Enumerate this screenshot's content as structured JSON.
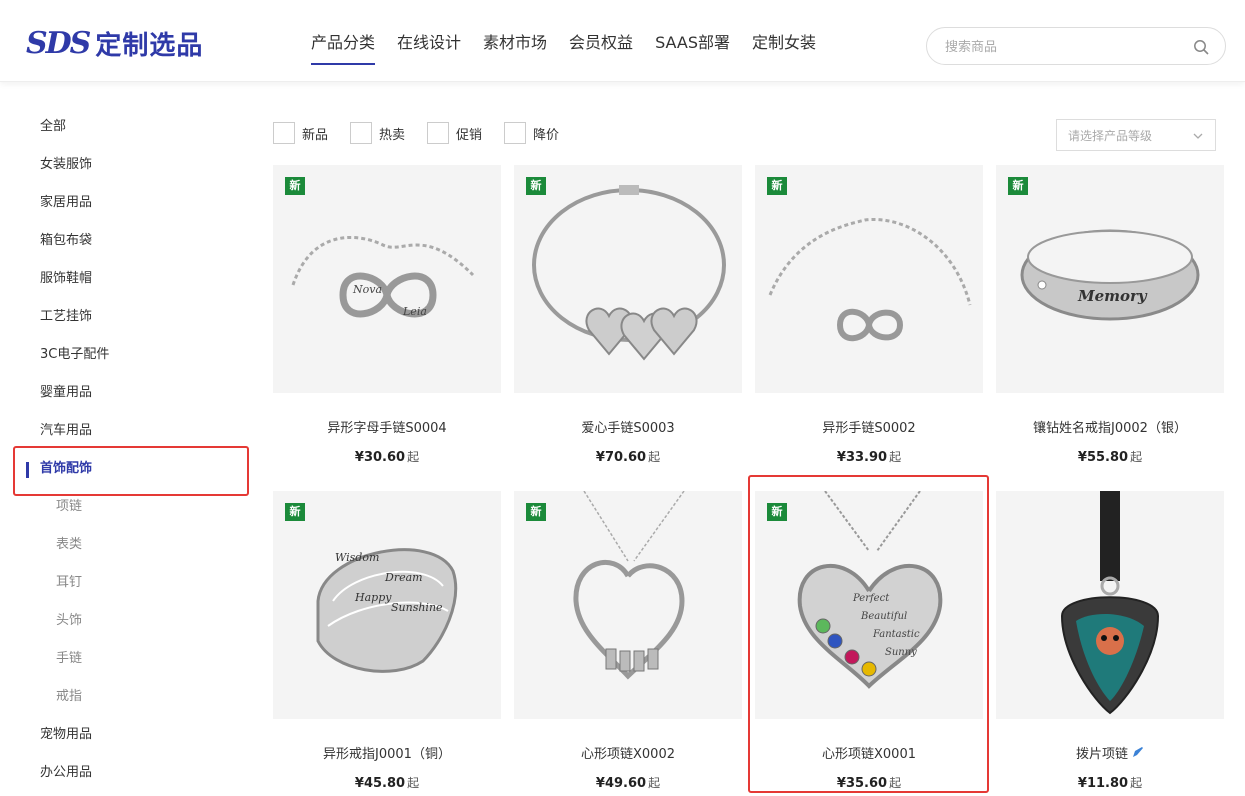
{
  "header": {
    "logo_mark": "SDS",
    "logo_text": "定制选品",
    "nav": [
      "产品分类",
      "在线设计",
      "素材市场",
      "会员权益",
      "SAAS部署",
      "定制女装"
    ],
    "search_placeholder": "搜索商品"
  },
  "sidebar": {
    "categories": [
      "全部",
      "女装服饰",
      "家居用品",
      "箱包布袋",
      "服饰鞋帽",
      "工艺挂饰",
      "3C电子配件",
      "婴童用品",
      "汽车用品",
      "首饰配饰"
    ],
    "active_category": "首饰配饰",
    "subcategories": [
      "项链",
      "表类",
      "耳钉",
      "头饰",
      "手链",
      "戒指"
    ],
    "categories_after": [
      "宠物用品",
      "办公用品"
    ]
  },
  "filters": {
    "options": [
      "新品",
      "热卖",
      "促销",
      "降价"
    ],
    "grade_placeholder": "请选择产品等级"
  },
  "products": [
    {
      "name": "异形字母手链S0004",
      "price": "¥30.60",
      "suffix": "起",
      "badge": "新",
      "icon": "infinity-bracelet-image"
    },
    {
      "name": "爱心手链S0003",
      "price": "¥70.60",
      "suffix": "起",
      "badge": "新",
      "icon": "heart-charm-bangle-image"
    },
    {
      "name": "异形手链S0002",
      "price": "¥33.90",
      "suffix": "起",
      "badge": "新",
      "icon": "infinity-chain-bracelet-image"
    },
    {
      "name": "镶钻姓名戒指J0002（银）",
      "price": "¥55.80",
      "suffix": "起",
      "badge": "新",
      "icon": "memory-ring-image"
    },
    {
      "name": "异形戒指J0001（铜）",
      "price": "¥45.80",
      "suffix": "起",
      "badge": "新",
      "icon": "engraved-wrap-ring-image"
    },
    {
      "name": "心形项链X0002",
      "price": "¥49.60",
      "suffix": "起",
      "badge": "新",
      "icon": "open-heart-necklace-image"
    },
    {
      "name": "心形项链X0001",
      "price": "¥35.60",
      "suffix": "起",
      "badge": "新",
      "icon": "birthstone-heart-necklace-image"
    },
    {
      "name": "拨片项链",
      "price": "¥11.80",
      "suffix": "起",
      "badge": "",
      "icon": "guitar-pick-necklace-image"
    }
  ],
  "colors": {
    "brand": "#2f3aa8",
    "new_badge": "#1b8a3a",
    "highlight": "#e53935"
  }
}
